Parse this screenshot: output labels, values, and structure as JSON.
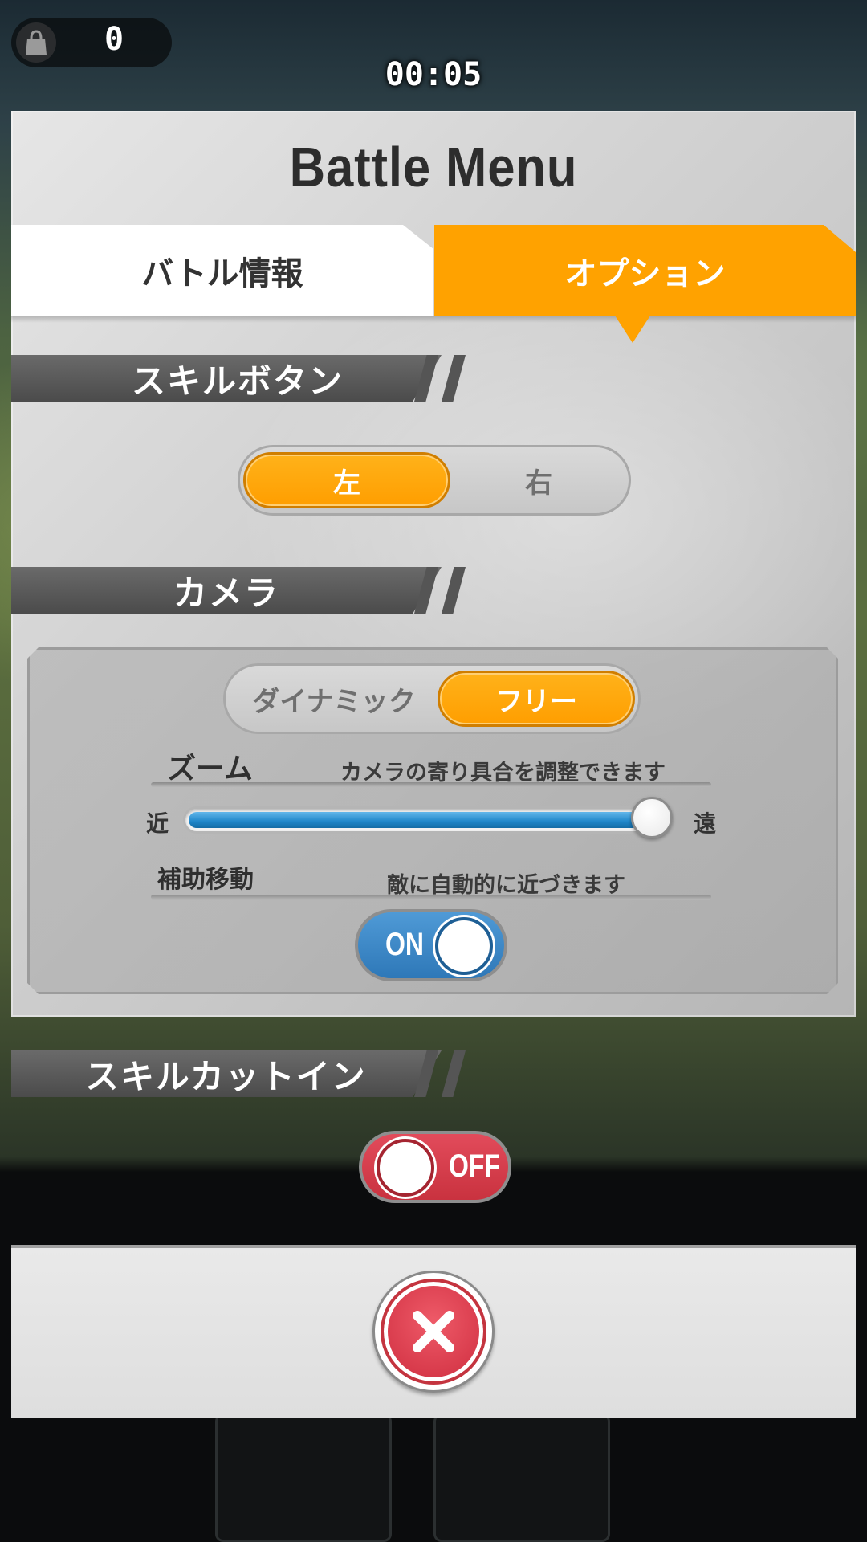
{
  "hud": {
    "item_count": "0",
    "timer": "00:05"
  },
  "dialog": {
    "title": "Battle Menu",
    "tabs": [
      {
        "label": "バトル情報",
        "active": false
      },
      {
        "label": "オプション",
        "active": true
      }
    ],
    "skill_button": {
      "header": "スキルボタン",
      "options": [
        "左",
        "右"
      ],
      "selected": "左"
    },
    "camera": {
      "header": "カメラ",
      "modes": [
        "ダイナミック",
        "フリー"
      ],
      "selected_mode": "フリー",
      "zoom": {
        "label": "ズーム",
        "description": "カメラの寄り具合を調整できます",
        "min_label": "近",
        "max_label": "遠",
        "value_fraction": 1.0
      },
      "assist_move": {
        "label": "補助移動",
        "description": "敵に自動的に近づきます",
        "state": "ON"
      }
    },
    "skill_cutin": {
      "header": "スキルカットイン",
      "state": "OFF"
    }
  },
  "colors": {
    "accent_orange": "#ffa200",
    "on_blue": "#2e78b8",
    "off_red": "#c9323f",
    "close_red": "#d7394a"
  },
  "icons": {
    "hud": "bag-icon",
    "close": "close-icon"
  }
}
